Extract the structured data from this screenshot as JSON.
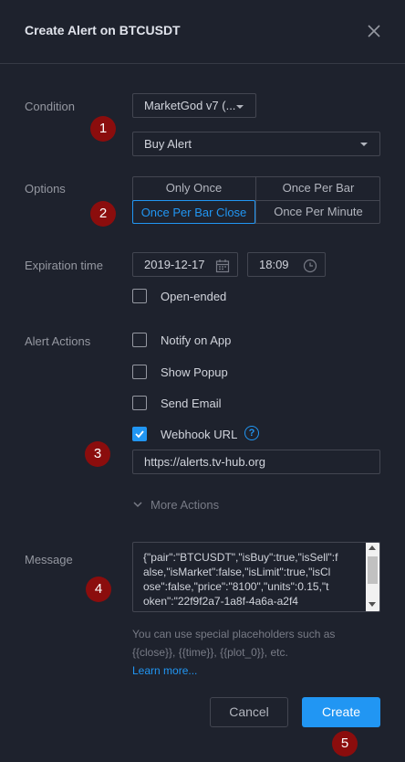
{
  "dialog": {
    "title": "Create Alert on BTCUSDT"
  },
  "condition": {
    "label": "Condition",
    "indicator": "MarketGod v7 (...",
    "alert": "Buy Alert"
  },
  "options": {
    "label": "Options",
    "items": [
      "Only Once",
      "Once Per Bar",
      "Once Per Bar Close",
      "Once Per Minute"
    ],
    "selected": "Once Per Bar Close"
  },
  "expiration": {
    "label": "Expiration time",
    "date": "2019-12-17",
    "time": "18:09",
    "open_ended_label": "Open-ended"
  },
  "actions": {
    "label": "Alert Actions",
    "notify_app": "Notify on App",
    "show_popup": "Show Popup",
    "send_email": "Send Email",
    "webhook": "Webhook URL",
    "webhook_url": "https://alerts.tv-hub.org",
    "more_actions": "More Actions"
  },
  "message": {
    "label": "Message",
    "lines": [
      "{\"pair\":\"BTCUSDT\",\"isBuy\":true,\"isSell\":f",
      "alse,\"isMarket\":false,\"isLimit\":true,\"isCl",
      "ose\":false,\"price\":\"8100\",\"units\":0.15,\"t",
      "oken\":\"22f9f2a7-1a8f-4a6a-a2f4"
    ],
    "hint_line1": "You can use special placeholders such as",
    "hint_line2": "{{close}}, {{time}}, {{plot_0}}, etc.",
    "learn_more": "Learn more..."
  },
  "buttons": {
    "cancel": "Cancel",
    "create": "Create"
  },
  "badges": [
    "1",
    "2",
    "3",
    "4",
    "5"
  ],
  "colors": {
    "background": "#1e222d",
    "accent": "#2196f3",
    "badge": "#8b0d0d",
    "border": "#434651"
  }
}
